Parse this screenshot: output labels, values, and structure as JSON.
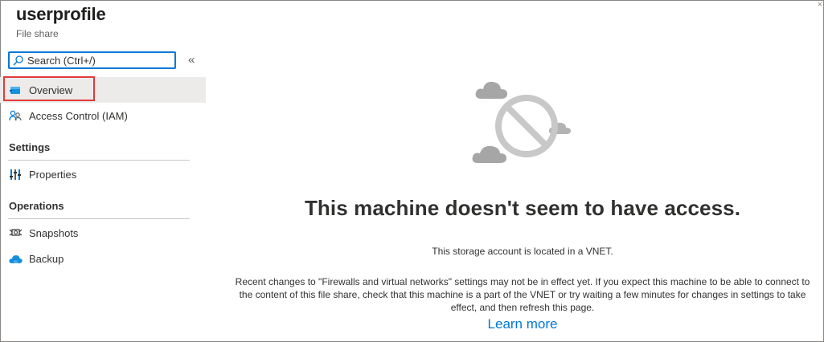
{
  "header": {
    "title": "userprofile",
    "subtitle": "File share"
  },
  "search": {
    "placeholder": "Search (Ctrl+/)"
  },
  "collapse_glyph": "«",
  "sidebar": {
    "items": [
      {
        "label": "Overview",
        "icon": "file-share-icon",
        "active": true
      },
      {
        "label": "Access Control (IAM)",
        "icon": "people-icon"
      }
    ],
    "sections": [
      {
        "title": "Settings",
        "items": [
          {
            "label": "Properties",
            "icon": "properties-icon"
          }
        ]
      },
      {
        "title": "Operations",
        "items": [
          {
            "label": "Snapshots",
            "icon": "snapshots-icon"
          },
          {
            "label": "Backup",
            "icon": "backup-cloud-icon"
          }
        ]
      }
    ]
  },
  "main": {
    "headline": "This machine doesn't seem to have access.",
    "subtext": "This storage account is located in a VNET.",
    "body": "Recent changes to \"Firewalls and virtual networks\" settings may not be in effect yet. If you expect this machine to be able to connect to the content of this file share, check that this machine is a part of the VNET or try waiting a few minutes for changes in settings to take effect, and then refresh this page.",
    "link": "Learn more",
    "illustration": "no-access-cloud-icon"
  },
  "colors": {
    "accent": "#0078d4",
    "highlight": "#e03b3b",
    "active_bg": "#edebe9"
  }
}
